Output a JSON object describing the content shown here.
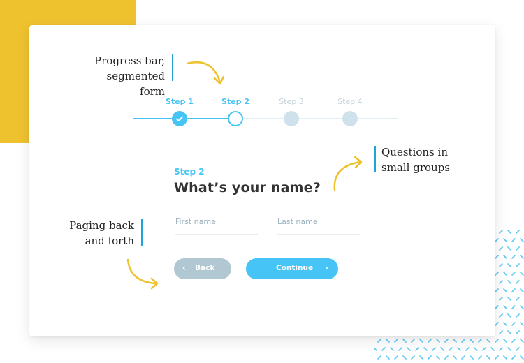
{
  "colors": {
    "accent": "#45C4F5",
    "inactive_step": "#CFE2EC",
    "inactive_label": "#C5D3DA",
    "back_button": "#B1C7D2",
    "yellow": "#EEC22F",
    "annotation_bar": "#1FA3D8"
  },
  "annotations": {
    "progress": {
      "line1": "Progress bar,",
      "line2": "segmented form"
    },
    "questions": {
      "line1": "Questions in",
      "line2": "small groups"
    },
    "paging": {
      "line1": "Paging back",
      "line2": "and forth"
    }
  },
  "progress": {
    "current_step": 2,
    "total_steps": 4,
    "steps": [
      {
        "label": "Step 1",
        "status": "completed",
        "icon": "check-icon"
      },
      {
        "label": "Step 2",
        "status": "current"
      },
      {
        "label": "Step 3",
        "status": "upcoming"
      },
      {
        "label": "Step 4",
        "status": "upcoming"
      }
    ]
  },
  "form": {
    "step_label": "Step 2",
    "title": "What’s your name?",
    "fields": {
      "first_name": {
        "placeholder": "First name",
        "value": ""
      },
      "last_name": {
        "placeholder": "Last name",
        "value": ""
      }
    },
    "buttons": {
      "back": {
        "label": "Back",
        "icon": "chevron-left-icon"
      },
      "continue": {
        "label": "Continue",
        "icon": "chevron-right-icon"
      }
    }
  }
}
